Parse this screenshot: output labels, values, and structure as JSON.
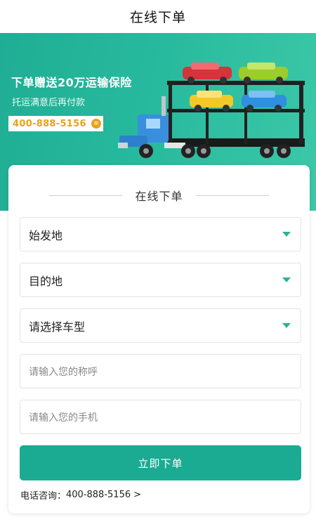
{
  "header": {
    "title": "在线下单"
  },
  "banner": {
    "headline": "下单赠送20万运输保险",
    "subline": "托运满意后再付款",
    "phone": "400-888-5156",
    "badge": "≡",
    "colors": {
      "gradient_start": "#1fae95",
      "gradient_end": "#3cc8a8",
      "phone_text": "#e8a21a"
    }
  },
  "form": {
    "section_title": "在线下单",
    "origin_label": "始发地",
    "destination_label": "目的地",
    "car_type_label": "请选择车型",
    "name_placeholder": "请输入您的称呼",
    "phone_placeholder": "请输入您的手机",
    "submit_label": "立即下单",
    "hotline_label": "电话咨询：",
    "hotline_number": "400-888-5156",
    "hotline_arrow": ">",
    "accent_color": "#1bab93"
  }
}
